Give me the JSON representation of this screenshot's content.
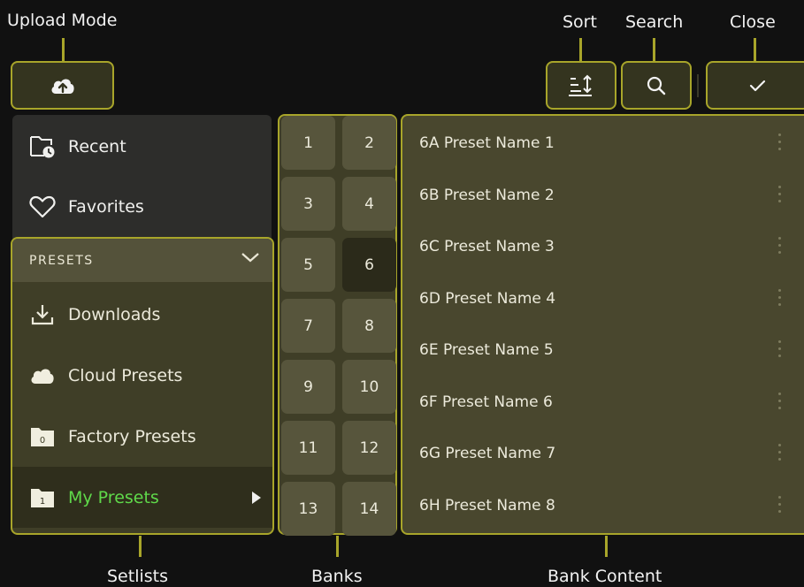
{
  "callouts": {
    "upload_mode": "Upload Mode",
    "sort": "Sort",
    "search": "Search",
    "close": "Close",
    "setlists": "Setlists",
    "banks": "Banks",
    "bank_content": "Bank Content"
  },
  "toolbar": {
    "upload_icon": "cloud-upload-icon",
    "sort_icon": "sort-icon",
    "search_icon": "search-icon",
    "close_icon": "check-icon"
  },
  "sidebar": {
    "recent": {
      "label": "Recent",
      "icon": "folder-clock-icon"
    },
    "favorites": {
      "label": "Favorites",
      "icon": "heart-icon"
    },
    "presets_header": "PRESETS",
    "items": [
      {
        "label": "Downloads",
        "icon": "download-icon"
      },
      {
        "label": "Cloud Presets",
        "icon": "cloud-icon"
      },
      {
        "label": "Factory Presets",
        "icon": "folder-0-icon",
        "badge": "0"
      },
      {
        "label": "My Presets",
        "icon": "folder-1-icon",
        "badge": "1",
        "selected": true
      }
    ]
  },
  "banks": {
    "items": [
      "1",
      "2",
      "3",
      "4",
      "5",
      "6",
      "7",
      "8",
      "9",
      "10",
      "11",
      "12",
      "13",
      "14"
    ],
    "active": "6"
  },
  "bank_content": {
    "presets": [
      "6A Preset Name 1",
      "6B Preset Name 2",
      "6C Preset Name 3",
      "6D Preset Name 4",
      "6E Preset Name 5",
      "6F Preset Name 6",
      "6G Preset Name 7",
      "6H Preset Name 8"
    ]
  },
  "colors": {
    "accent": "#a8a52a",
    "selected_text": "#5fd94a",
    "panel": "#3f3e27",
    "content_panel": "#49472e"
  }
}
